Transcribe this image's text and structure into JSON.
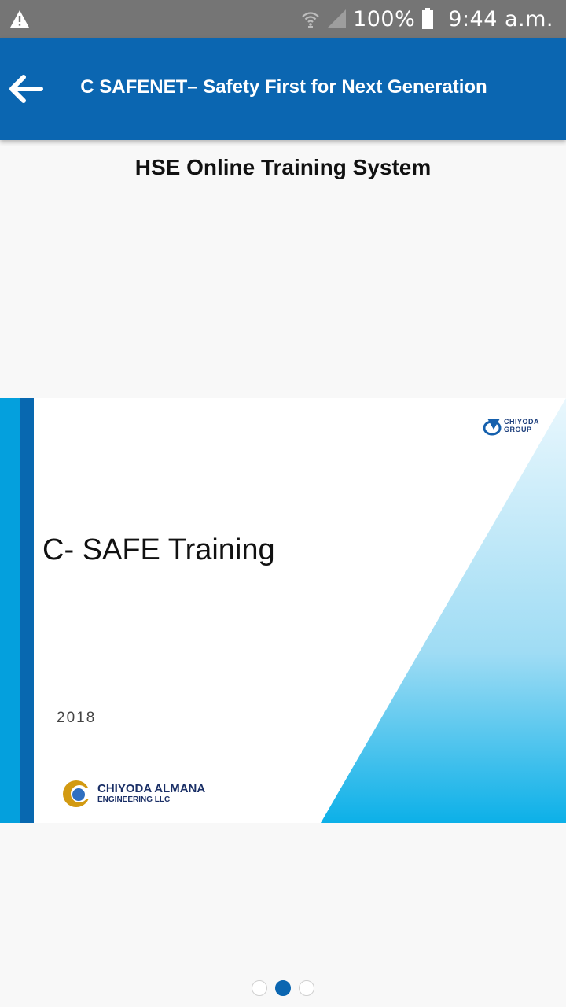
{
  "status_bar": {
    "battery_percent": "100%",
    "time": "9:44 a.m.",
    "icons": [
      "warning-icon",
      "wifi-icon",
      "signal-icon",
      "battery-icon"
    ]
  },
  "app_bar": {
    "title": "C SAFENET– Safety First for Next Generation",
    "back_icon": "arrow-left-icon",
    "color": "#0b66b1"
  },
  "page": {
    "heading": "HSE Online Training System"
  },
  "slide": {
    "title": "C- SAFE Training",
    "year": "2018",
    "corner_logo_text": "CHIYODA GROUP",
    "company_name": "CHIYODA ALMANA",
    "company_subtitle": "ENGINEERING LLC"
  },
  "pager": {
    "count": 3,
    "active_index": 1
  },
  "colors": {
    "status_bar": "#757575",
    "accent": "#0b66b1",
    "slide_light_blue": "#04a0dd"
  }
}
